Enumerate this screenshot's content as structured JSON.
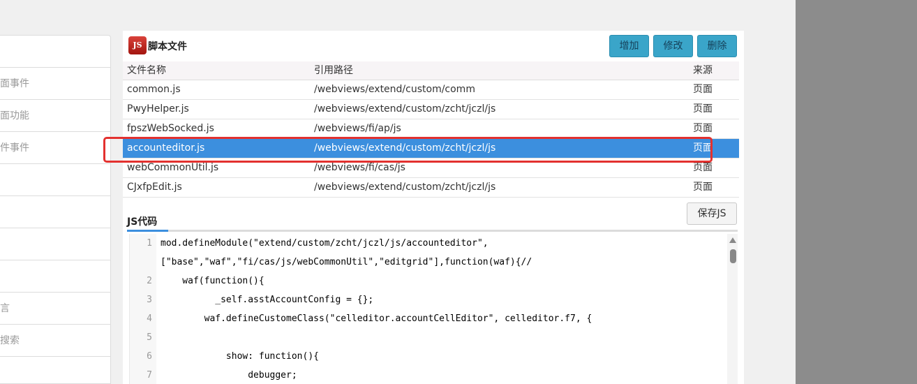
{
  "sidebar": {
    "items": [
      "",
      "面事件",
      "面功能",
      "件事件",
      "",
      "",
      "",
      "",
      "言",
      "搜索"
    ]
  },
  "panel": {
    "badge": "JS",
    "title": "脚本文件",
    "buttons": {
      "add": "增加",
      "edit": "修改",
      "delete": "删除"
    }
  },
  "table": {
    "headers": {
      "name": "文件名称",
      "path": "引用路径",
      "source": "来源"
    },
    "rows": [
      {
        "name": "common.js",
        "path": "/webviews/extend/custom/comm",
        "source": "页面"
      },
      {
        "name": "PwyHelper.js",
        "path": "/webviews/extend/custom/zcht/jczl/js",
        "source": "页面"
      },
      {
        "name": "fpszWebSocked.js",
        "path": "/webviews/fi/ap/js",
        "source": "页面"
      },
      {
        "name": "accounteditor.js",
        "path": "/webviews/extend/custom/zcht/jczl/js",
        "source": "页面",
        "selected": true
      },
      {
        "name": "webCommonUtil.js",
        "path": "/webviews/fi/cas/js",
        "source": "页面"
      },
      {
        "name": "CJxfpEdit.js",
        "path": "/webviews/extend/custom/zcht/jczl/js",
        "source": "页面"
      }
    ]
  },
  "save_label": "保存JS",
  "code_tab": "JS代码",
  "code": {
    "line_numbers": [
      "1",
      "",
      "2",
      "3",
      "4",
      "5",
      "6",
      "7"
    ],
    "lines": [
      "mod.defineModule(\"extend/custom/zcht/jczl/js/accounteditor\",",
      "[\"base\",\"waf\",\"fi/cas/js/webCommonUtil\",\"editgrid\"],function(waf){//",
      "    waf(function(){",
      "          _self.asstAccountConfig = {};",
      "        waf.defineCustomeClass(\"celleditor.accountCellEditor\", celleditor.f7, {",
      "",
      "            show: function(){",
      "                debugger;"
    ]
  },
  "colors": {
    "selected_row": "#3c8fde",
    "highlight_border": "#e3312f",
    "button": "#3aa5c9"
  }
}
